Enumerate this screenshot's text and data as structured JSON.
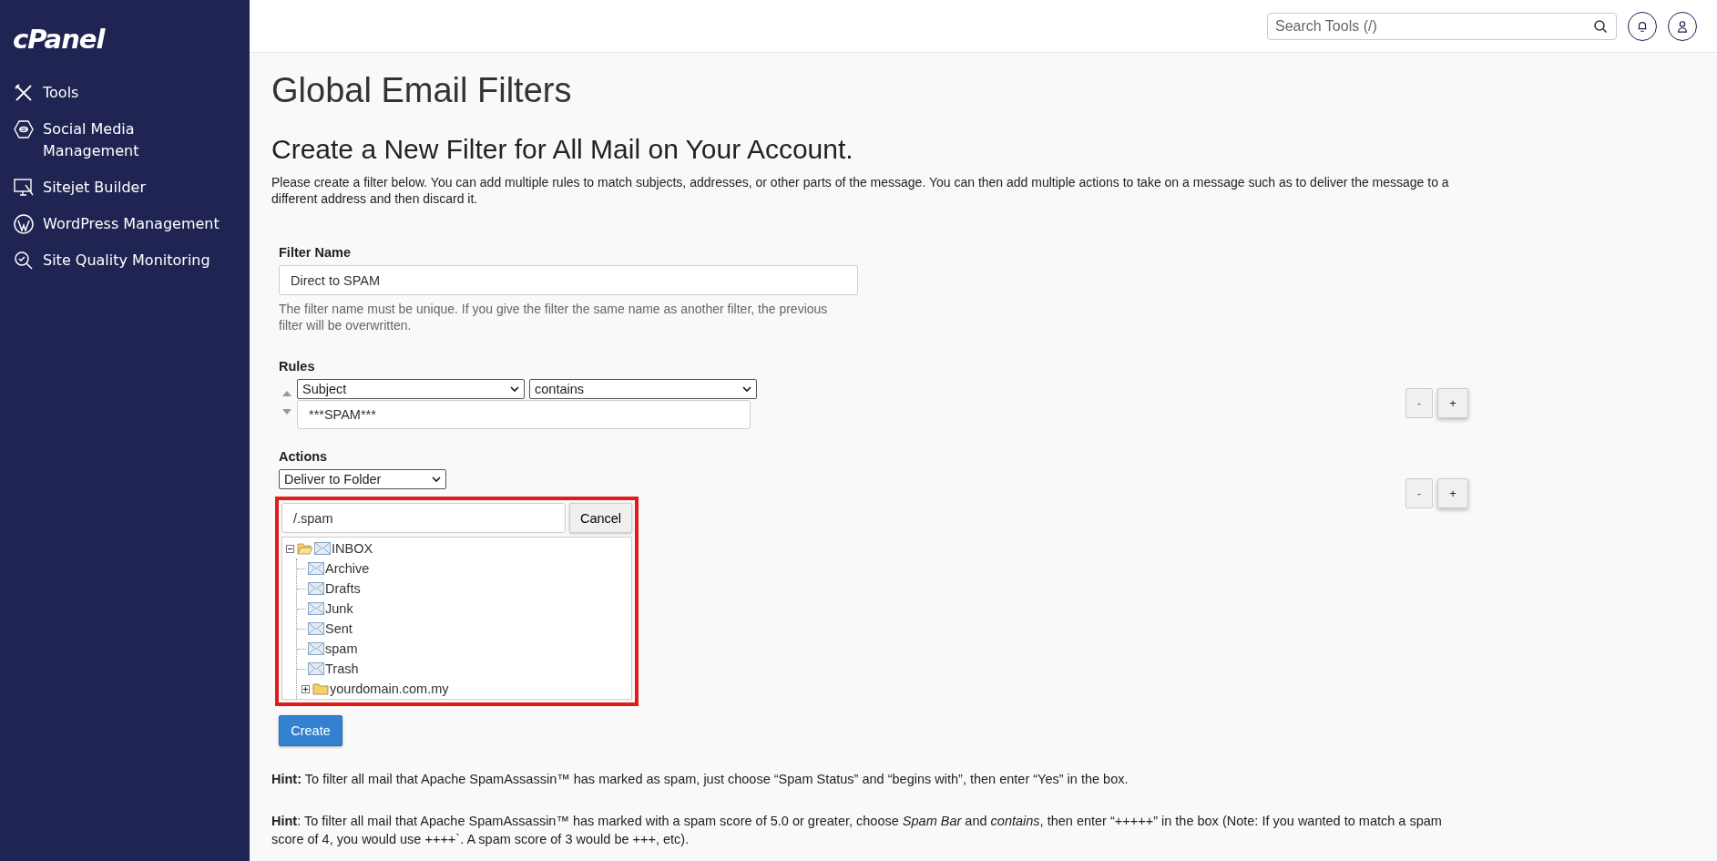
{
  "sidebar": {
    "logo": "cPanel",
    "items": [
      {
        "label": "Tools"
      },
      {
        "label": "Social Media Management"
      },
      {
        "label": "Sitejet Builder"
      },
      {
        "label": "WordPress Management"
      },
      {
        "label": "Site Quality Monitoring"
      }
    ]
  },
  "header": {
    "search": {
      "placeholder": "Search Tools (/)"
    }
  },
  "page": {
    "title": "Global Email Filters",
    "heading": "Create a New Filter for All Mail on Your Account.",
    "description": "Please create a filter below. You can add multiple rules to match subjects, addresses, or other parts of the message. You can then add multiple actions to take on a message such as to deliver the message to a different address and then discard it."
  },
  "filter_name": {
    "label": "Filter Name",
    "value": "Direct to SPAM",
    "help": "The filter name must be unique. If you give the filter the same name as another filter, the previous filter will be overwritten."
  },
  "rules": {
    "label": "Rules",
    "field": "Subject",
    "operator": "contains",
    "value": "***SPAM***",
    "remove_button": "-",
    "add_button": "+"
  },
  "actions": {
    "label": "Actions",
    "action": "Deliver to Folder",
    "remove_button": "-",
    "add_button": "+",
    "folder_picker": {
      "value": "/.spam",
      "cancel_button": "Cancel",
      "tree": [
        {
          "label": "INBOX",
          "kind": "mailbox",
          "expanded": true,
          "children": [
            {
              "label": "Archive",
              "kind": "mailbox"
            },
            {
              "label": "Drafts",
              "kind": "mailbox"
            },
            {
              "label": "Junk",
              "kind": "mailbox"
            },
            {
              "label": "Sent",
              "kind": "mailbox"
            },
            {
              "label": "spam",
              "kind": "mailbox"
            },
            {
              "label": "Trash",
              "kind": "mailbox"
            },
            {
              "label": "yourdomain.com.my",
              "kind": "folder",
              "expanded": false
            }
          ]
        }
      ]
    }
  },
  "create_button": "Create",
  "hints": [
    "**Hint:** To filter all mail that Apache SpamAssassin™ has marked as spam, just choose “Spam Status” and “begins with”, then enter “Yes” in the box.",
    "**Hint**: To filter all mail that Apache SpamAssassin™ has marked with a spam score of 5.0 or greater, choose *Spam Bar* and *contains*, then enter “+++++” in the box (Note: If you wanted to match a spam score of 4, you would use ++++`. A spam score of 3 would be +++, etc)."
  ]
}
